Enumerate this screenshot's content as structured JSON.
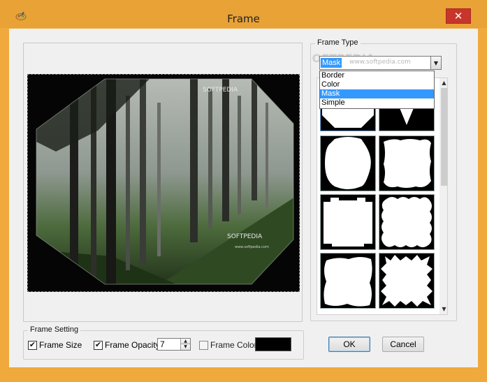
{
  "window": {
    "title": "Frame",
    "close_glyph": "✕"
  },
  "preview": {
    "watermark_top": "SOFTPEDIA",
    "watermark_bottom": "SOFTPEDIA",
    "watermark_url": "www.softpedia.com"
  },
  "frame_type": {
    "legend": "Frame Type",
    "selected": "Mask",
    "options": [
      "Border",
      "Color",
      "Mask",
      "Simple"
    ],
    "selected_index": 2,
    "combo_watermark": "SOFTPEDIA",
    "combo_watermark_url": "www.softpedia.com"
  },
  "frame_setting": {
    "legend": "Frame Setting",
    "frame_size_label": "Frame Size",
    "frame_size_checked": true,
    "frame_opacity_label": "Frame Opacity",
    "frame_opacity_checked": true,
    "opacity_value": "7",
    "frame_color_label": "Frame Color",
    "frame_color_checked": false,
    "frame_color_value": "#000000"
  },
  "buttons": {
    "ok": "OK",
    "cancel": "Cancel"
  },
  "colors": {
    "titlebar": "#e8a236",
    "close": "#c8352b",
    "selection": "#3399ff",
    "client": "#f0f0f0"
  },
  "icons": {
    "app": "palette-icon",
    "dropdown": "chevron-down-icon",
    "scroll_up": "arrow-up-icon",
    "scroll_down": "arrow-down-icon"
  }
}
